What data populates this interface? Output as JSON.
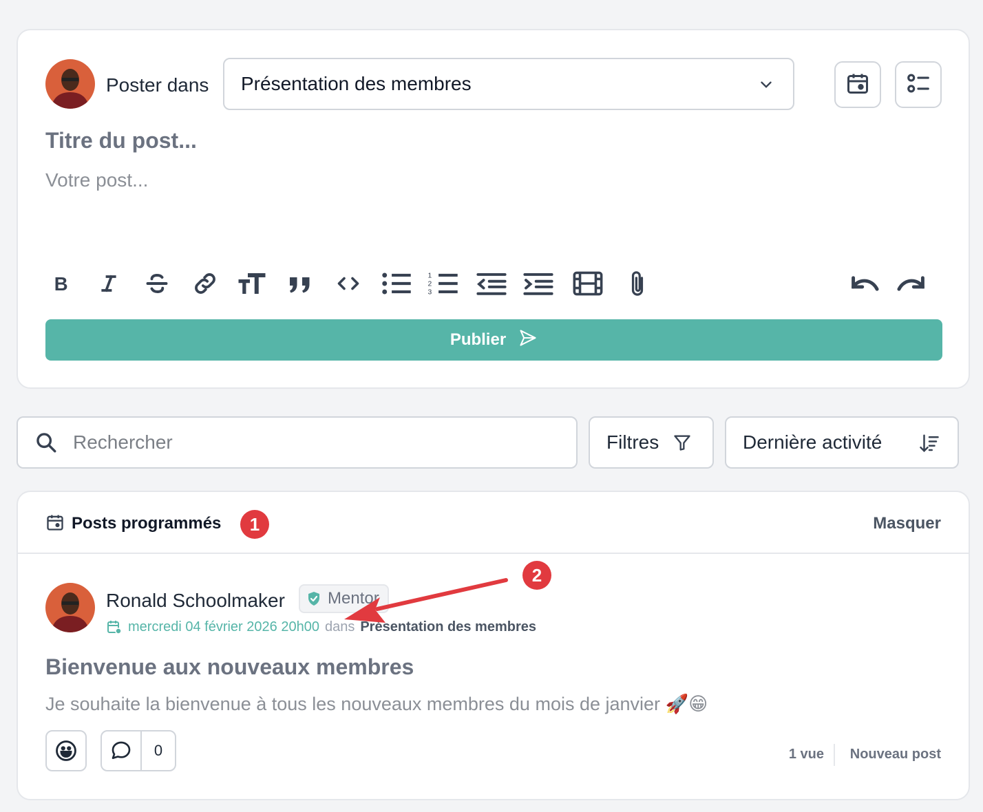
{
  "composer": {
    "poster_label": "Poster dans",
    "space_selected": "Présentation des membres",
    "title_placeholder": "Titre du post...",
    "body_placeholder": "Votre post...",
    "toolbar_icons": [
      "bold-icon",
      "italic-icon",
      "strikethrough-icon",
      "link-icon",
      "text-size-icon",
      "quote-icon",
      "code-icon",
      "bullet-list-icon",
      "numbered-list-icon",
      "outdent-icon",
      "indent-icon",
      "video-icon",
      "attachment-icon",
      "undo-icon",
      "redo-icon"
    ],
    "publish_label": "Publier"
  },
  "search": {
    "placeholder": "Rechercher"
  },
  "filters": {
    "label": "Filtres"
  },
  "sort": {
    "label": "Dernière activité"
  },
  "scheduled": {
    "title": "Posts programmés",
    "hide_label": "Masquer",
    "post": {
      "author": "Ronald Schoolmaker",
      "role": "Mentor",
      "date": "mercredi 04 février 2026 20h00",
      "in_label": "dans",
      "space": "Présentation des membres",
      "title": "Bienvenue aux nouveaux membres",
      "text": "Je souhaite la bienvenue à tous les nouveaux membres du mois de janvier 🚀😁",
      "comment_count": "0",
      "views": "1 vue",
      "status": "Nouveau post"
    }
  },
  "annotations": {
    "badge_1": "1",
    "badge_2": "2"
  },
  "colors": {
    "accent": "#56b5a8",
    "badge": "#e13a3f",
    "arrow": "#e13a3f"
  }
}
